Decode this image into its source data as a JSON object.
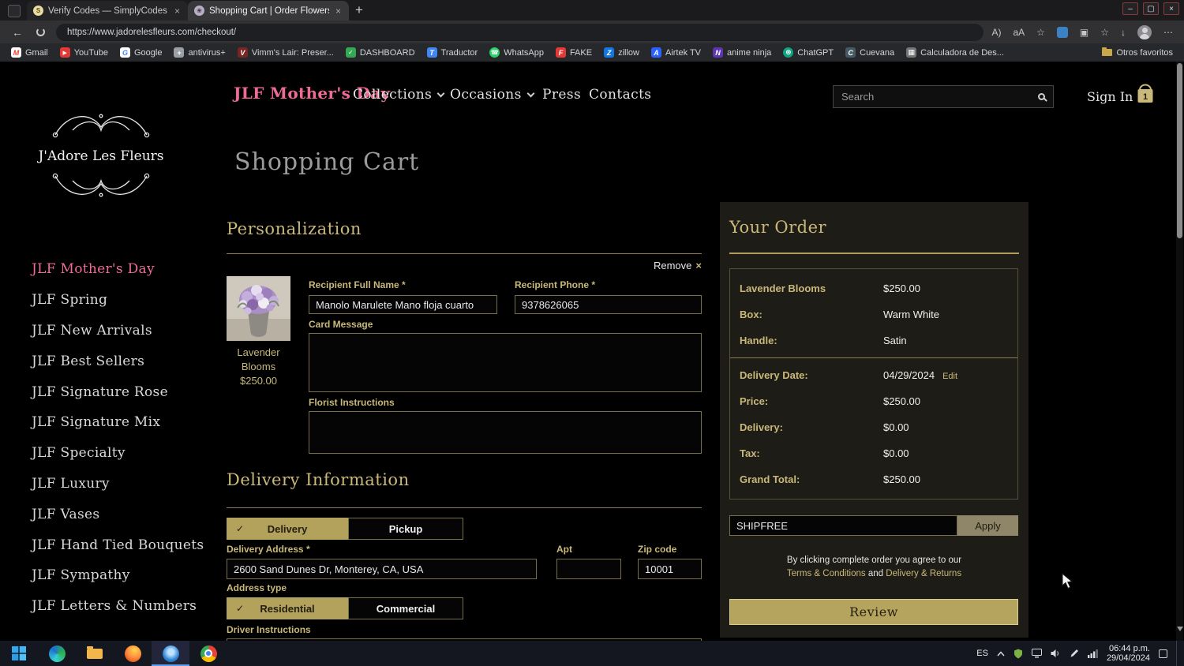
{
  "browser": {
    "tabs": [
      {
        "title": "Verify Codes — SimplyCodes"
      },
      {
        "title": "Shopping Cart | Order Flowers..."
      }
    ],
    "url": "https://www.jadorelesfleurs.com/checkout/",
    "bookmarks": [
      {
        "label": "Gmail",
        "glyph": "M"
      },
      {
        "label": "YouTube",
        "glyph": "▶"
      },
      {
        "label": "Google",
        "glyph": "G"
      },
      {
        "label": "antivirus+",
        "glyph": "+"
      },
      {
        "label": "Vimm's Lair: Preser...",
        "glyph": "V"
      },
      {
        "label": "DASHBOARD",
        "glyph": "✓"
      },
      {
        "label": "Traductor",
        "glyph": "T"
      },
      {
        "label": "WhatsApp",
        "glyph": "☎"
      },
      {
        "label": "FAKE",
        "glyph": "F"
      },
      {
        "label": "zillow",
        "glyph": "Z"
      },
      {
        "label": "Airtek TV",
        "glyph": "A"
      },
      {
        "label": "anime ninja",
        "glyph": "N"
      },
      {
        "label": "ChatGPT",
        "glyph": "⊛"
      },
      {
        "label": "Cuevana",
        "glyph": "C"
      },
      {
        "label": "Calculadora de Des...",
        "glyph": "▦"
      }
    ],
    "other_favorites": "Otros favoritos"
  },
  "logo": {
    "name": "J'Adore Les Fleurs"
  },
  "nav": {
    "brand": "JLF Mother's Day",
    "collections": "Collections",
    "occasions": "Occasions",
    "press": "Press",
    "contacts": "Contacts",
    "search_placeholder": "Search",
    "sign_in": "Sign In",
    "cart_count": "1"
  },
  "sidebar": {
    "items": [
      "JLF Mother's Day",
      "JLF Spring",
      "JLF New Arrivals",
      "JLF Best Sellers",
      "JLF Signature Rose",
      "JLF Signature Mix",
      "JLF Specialty",
      "JLF Luxury",
      "JLF Vases",
      "JLF Hand Tied Bouquets",
      "JLF Sympathy",
      "JLF Letters & Numbers"
    ]
  },
  "cart": {
    "page_title": "Shopping Cart",
    "personalization": {
      "heading": "Personalization",
      "remove_label": "Remove",
      "product_name_line1": "Lavender",
      "product_name_line2": "Blooms",
      "product_price": "$250.00",
      "recipient_name_label": "Recipient Full Name",
      "required_mark": "*",
      "recipient_name_value": "Manolo Marulete Mano floja cuarto",
      "recipient_phone_label": "Recipient Phone",
      "recipient_phone_value": "9378626065",
      "card_message_label": "Card Message",
      "florist_instructions_label": "Florist Instructions"
    },
    "delivery": {
      "heading": "Delivery Information",
      "delivery_tab": "Delivery",
      "pickup_tab": "Pickup",
      "address_label": "Delivery Address",
      "address_value": "2600 Sand Dunes Dr, Monterey, CA, USA",
      "apt_label": "Apt",
      "zip_label": "Zip code",
      "zip_value": "10001",
      "address_type_label": "Address type",
      "residential": "Residential",
      "commercial": "Commercial",
      "driver_label": "Driver Instructions"
    }
  },
  "order": {
    "heading": "Your Order",
    "rows": [
      {
        "label": "Lavender Blooms",
        "value": "$250.00"
      },
      {
        "label": "Box:",
        "value": "Warm White"
      },
      {
        "label": "Handle:",
        "value": "Satin"
      },
      {
        "label": "Delivery Date:",
        "value": "04/29/2024",
        "edit": "Edit"
      },
      {
        "label": "Price:",
        "value": "$250.00"
      },
      {
        "label": "Delivery:",
        "value": "$0.00"
      },
      {
        "label": "Tax:",
        "value": "$0.00"
      },
      {
        "label": "Grand Total:",
        "value": "$250.00"
      }
    ],
    "promo_value": "SHIPFREE",
    "apply_label": "Apply",
    "agree_text": "By clicking complete order you agree to our",
    "terms_link": "Terms & Conditions",
    "and_text": "and",
    "returns_link": "Delivery & Returns",
    "review_label": "Review"
  },
  "taskbar": {
    "lang": "ES",
    "time": "06:44 p.m.",
    "date": "29/04/2024"
  },
  "theme": {
    "gold": "#c9b87a",
    "pink": "#ee6b94",
    "selected_gold": "#b2a25c"
  }
}
